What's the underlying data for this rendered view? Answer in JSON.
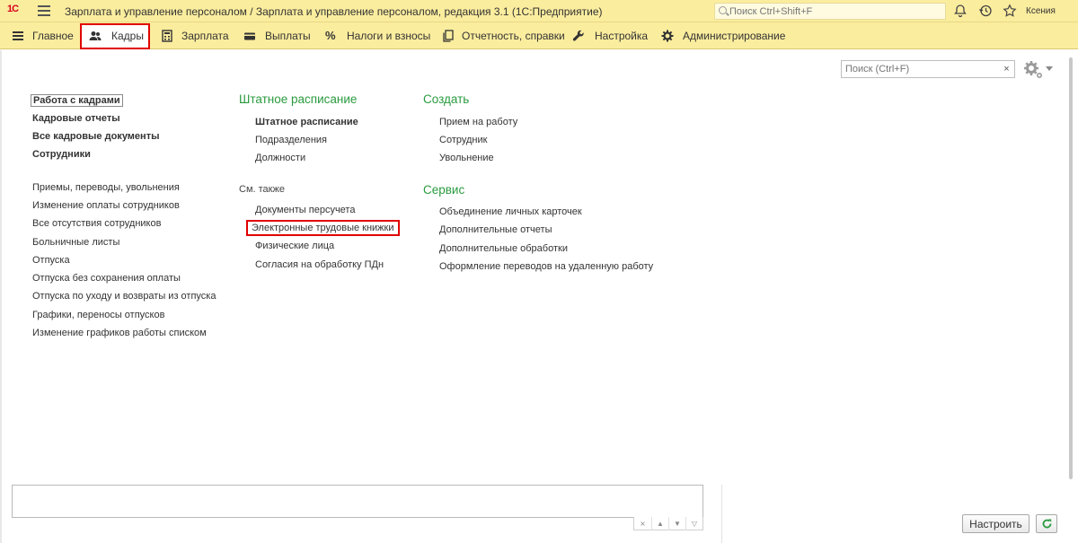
{
  "titlebar": {
    "logo": "1С",
    "title": "Зарплата и управление персоналом / Зарплата и управление персоналом, редакция 3.1   (1С:Предприятие)",
    "search_placeholder": "Поиск Ctrl+Shift+F",
    "user": "Ксения"
  },
  "sections": [
    {
      "label": "Главное",
      "icon": "list-icon"
    },
    {
      "label": "Кадры",
      "icon": "people-icon",
      "active": true
    },
    {
      "label": "Зарплата",
      "icon": "calculator-icon"
    },
    {
      "label": "Выплаты",
      "icon": "wallet-icon"
    },
    {
      "label": "Налоги и взносы",
      "icon": "percent-icon"
    },
    {
      "label": "Отчетность, справки",
      "icon": "documents-icon"
    },
    {
      "label": "Настройка",
      "icon": "wrench-icon"
    },
    {
      "label": "Администрирование",
      "icon": "gear-icon"
    }
  ],
  "panel": {
    "search_placeholder": "Поиск (Ctrl+F)",
    "clear": "×"
  },
  "left_column": {
    "main_links": [
      "Работа с кадрами",
      "Кадровые отчеты",
      "Все кадровые документы",
      "Сотрудники"
    ],
    "links": [
      "Приемы, переводы, увольнения",
      "Изменение оплаты сотрудников",
      "Все отсутствия сотрудников",
      "Больничные листы",
      "Отпуска",
      "Отпуска без сохранения оплаты",
      "Отпуска по уходу и возвраты из отпуска",
      "Графики, переносы отпусков",
      "Изменение графиков работы списком"
    ]
  },
  "middle_column": {
    "group_title": "Штатное расписание",
    "group_links": [
      "Штатное расписание",
      "Подразделения",
      "Должности"
    ],
    "see_also": "См. также",
    "see_also_links": [
      "Документы персучета",
      "Электронные трудовые книжки",
      "Физические лица",
      "Согласия на обработку ПДн"
    ]
  },
  "right_column": {
    "create_title": "Создать",
    "create_links": [
      "Прием на работу",
      "Сотрудник",
      "Увольнение"
    ],
    "service_title": "Сервис",
    "service_links": [
      "Объединение личных карточек",
      "Дополнительные отчеты",
      "Дополнительные обработки",
      "Оформление переводов на удаленную работу"
    ]
  },
  "bottom": {
    "configure_label": "Настроить"
  },
  "colors": {
    "header_bg": "#fbed9e",
    "group_title": "#2a9b3f",
    "highlight": "#e00000"
  }
}
